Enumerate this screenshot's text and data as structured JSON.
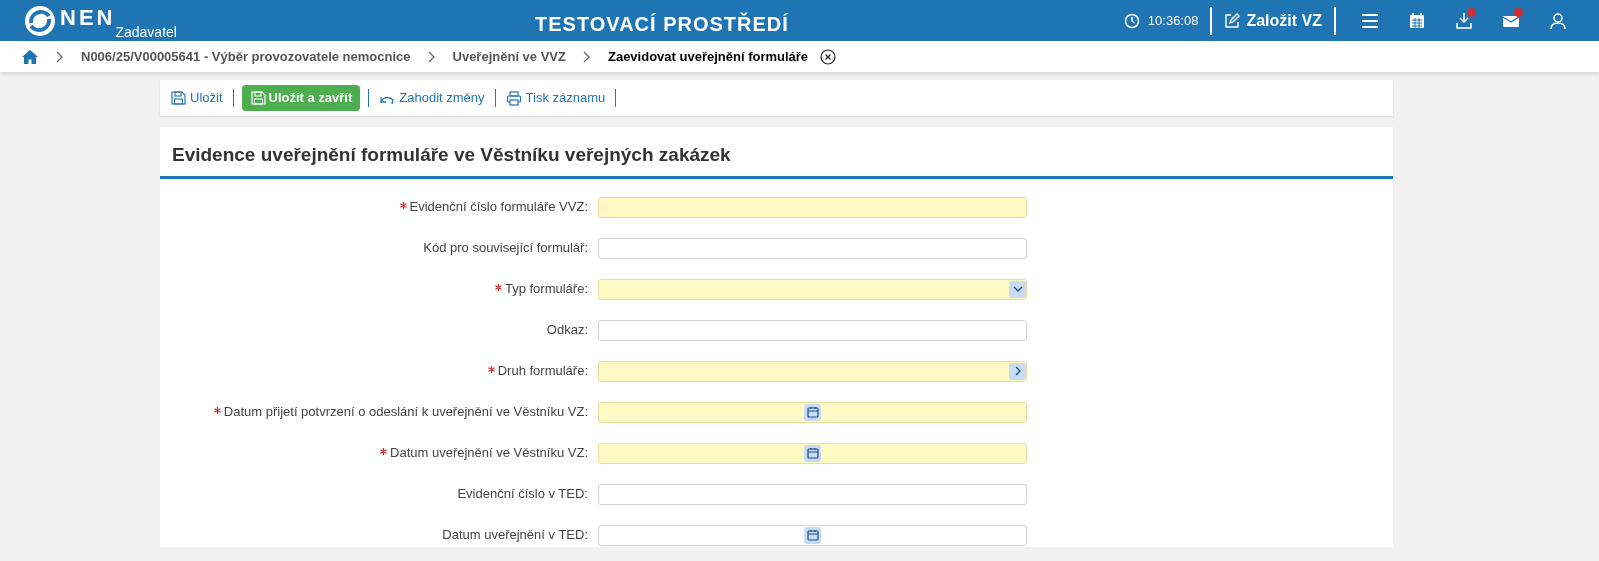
{
  "header": {
    "logo": "NEN",
    "logo_sub": "Zadavatel",
    "environment": "TESTOVACÍ PROSTŘEDÍ",
    "time": "10:36:08",
    "create_button": "Založit VZ",
    "icons": [
      {
        "kind": "menu",
        "badge": false
      },
      {
        "kind": "calendar",
        "badge": false
      },
      {
        "kind": "download",
        "badge": true
      },
      {
        "kind": "mail",
        "badge": true
      },
      {
        "kind": "user",
        "badge": false
      }
    ]
  },
  "breadcrumb": [
    {
      "label": "N006/25/V00005641 - Výběr provozovatele nemocnice",
      "current": false
    },
    {
      "label": "Uveřejnění ve VVZ",
      "current": false
    },
    {
      "label": "Zaevidovat uveřejnění formuláře",
      "current": true
    }
  ],
  "toolbar": [
    {
      "kind": "save",
      "label": "Uložit",
      "primary": false
    },
    {
      "kind": "save",
      "label": "Uložit a zavřít",
      "primary": true
    },
    {
      "kind": "discard",
      "label": "Zahodit změny",
      "primary": false
    },
    {
      "kind": "print",
      "label": "Tisk záznamu",
      "primary": false
    }
  ],
  "form": {
    "title": "Evidence uveřejnění formuláře ve Věstníku veřejných zakázek",
    "fields": [
      {
        "label": "Evidenční číslo formuláře VVZ:",
        "kind": "text",
        "required": true
      },
      {
        "label": "Kód pro související formulář:",
        "kind": "text",
        "required": false
      },
      {
        "label": "Typ formuláře:",
        "kind": "select",
        "required": true
      },
      {
        "label": "Odkaz:",
        "kind": "text",
        "required": false
      },
      {
        "label": "Druh formuláře:",
        "kind": "lookup",
        "required": true
      },
      {
        "label": "Datum přijetí potvrzení o odeslání k uveřejnění ve Věstníku VZ:",
        "kind": "date",
        "required": true
      },
      {
        "label": "Datum uveřejnění ve Věstníku VZ:",
        "kind": "date",
        "required": true
      },
      {
        "label": "Evidenční číslo v TED:",
        "kind": "text",
        "required": false
      },
      {
        "label": "Datum uveřejnění v TED:",
        "kind": "date",
        "required": false
      }
    ]
  }
}
